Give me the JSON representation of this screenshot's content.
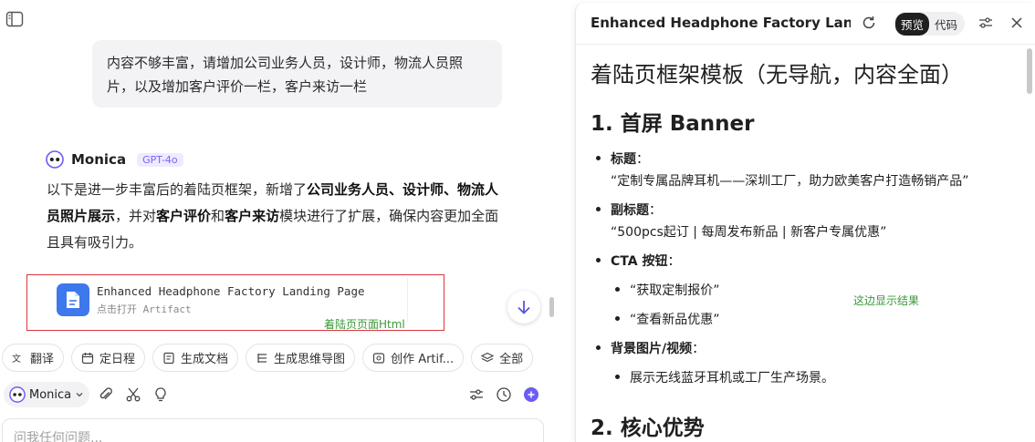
{
  "chat": {
    "user_message": "内容不够丰富，请增加公司业务人员，设计师，物流人员照片，以及增加客户评价一栏，客户来访一栏",
    "bot_name": "Monica",
    "model_badge": "GPT-4o",
    "reply_parts": [
      {
        "text": "以下是进一步丰富后的着陆页框架，新增了",
        "bold": false
      },
      {
        "text": "公司业务人员、设计师、物流人员照片展示",
        "bold": true
      },
      {
        "text": "，并对",
        "bold": false
      },
      {
        "text": "客户评价",
        "bold": true
      },
      {
        "text": "和",
        "bold": false
      },
      {
        "text": "客户来访",
        "bold": true
      },
      {
        "text": "模块进行了扩展，确保内容更加全面且具有吸引力。",
        "bold": false
      }
    ],
    "artifact": {
      "title": "Enhanced Headphone Factory Landing Page",
      "subtitle": "点击打开 Artifact",
      "note": "着陆页页面Html"
    }
  },
  "toolbar": {
    "chips": [
      {
        "label": "翻译",
        "icon": "translate-icon"
      },
      {
        "label": "定日程",
        "icon": "calendar-icon"
      },
      {
        "label": "生成文档",
        "icon": "document-icon"
      },
      {
        "label": "生成思维导图",
        "icon": "mindmap-icon"
      },
      {
        "label": "创作 Artif...",
        "icon": "artifact-icon"
      },
      {
        "label": "全部",
        "icon": "layers-icon"
      }
    ]
  },
  "composer": {
    "model_select": "Monica",
    "placeholder": "问我任何问题..."
  },
  "preview": {
    "title": "Enhanced Headphone Factory Landi...",
    "tabs": [
      "预览",
      "代码"
    ],
    "active_tab": "预览",
    "h1": "着陆页框架模板（无导航，内容全面）",
    "section1_title": "1. 首屏 Banner",
    "title_label": "标题",
    "title_value": "“定制专属品牌耳机——深圳工厂，助力欧美客户打造畅销产品”",
    "subtitle_label": "副标题",
    "subtitle_value": "“500pcs起订 | 每周发布新品 | 新客户专属优惠”",
    "cta_label": "CTA 按钮",
    "cta_items": [
      "“获取定制报价”",
      "“查看新品优惠”"
    ],
    "bg_label": "背景图片/视频",
    "bg_items": [
      "展示无线蓝牙耳机或工厂生产场景。"
    ],
    "result_note": "这边显示结果",
    "section2_title": "2. 核心优势"
  },
  "colors": {
    "artifact_icon": "#3d78ec",
    "annotation_box": "#d9363e",
    "annotation_text": "#3a9a3a",
    "badge_text": "#7b61ff",
    "active_tab_bg": "#1f1f1f"
  }
}
